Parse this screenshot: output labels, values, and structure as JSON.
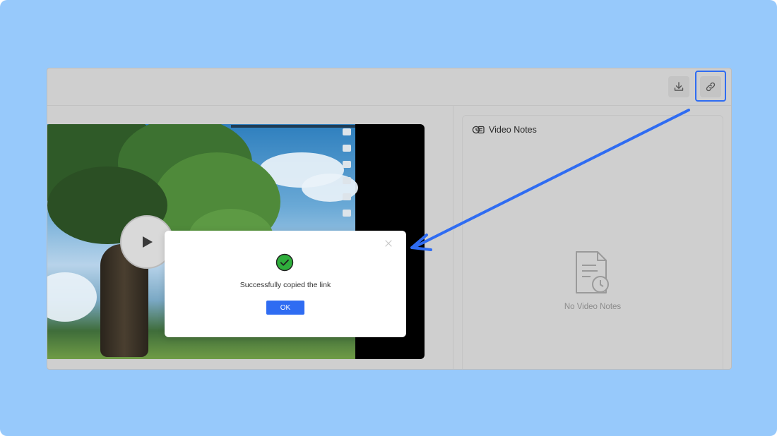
{
  "colors": {
    "background": "#97c9fb",
    "accent": "#2f6cf2",
    "success": "#2fae3c",
    "window": "#cfcfcf"
  },
  "toolbar": {
    "download_icon": "download-icon",
    "copy_link_icon": "link-icon"
  },
  "video": {
    "play_icon": "play-icon"
  },
  "notes": {
    "title": "Video Notes",
    "header_icon": "video-notes-icon",
    "empty_icon": "document-clock-icon",
    "empty_text": "No Video Notes"
  },
  "modal": {
    "success_icon": "check-circle-icon",
    "message": "Successfully copied the link",
    "ok_label": "OK",
    "close_icon": "close-icon"
  },
  "annotation": {
    "arrow_icon": "arrow-icon"
  }
}
